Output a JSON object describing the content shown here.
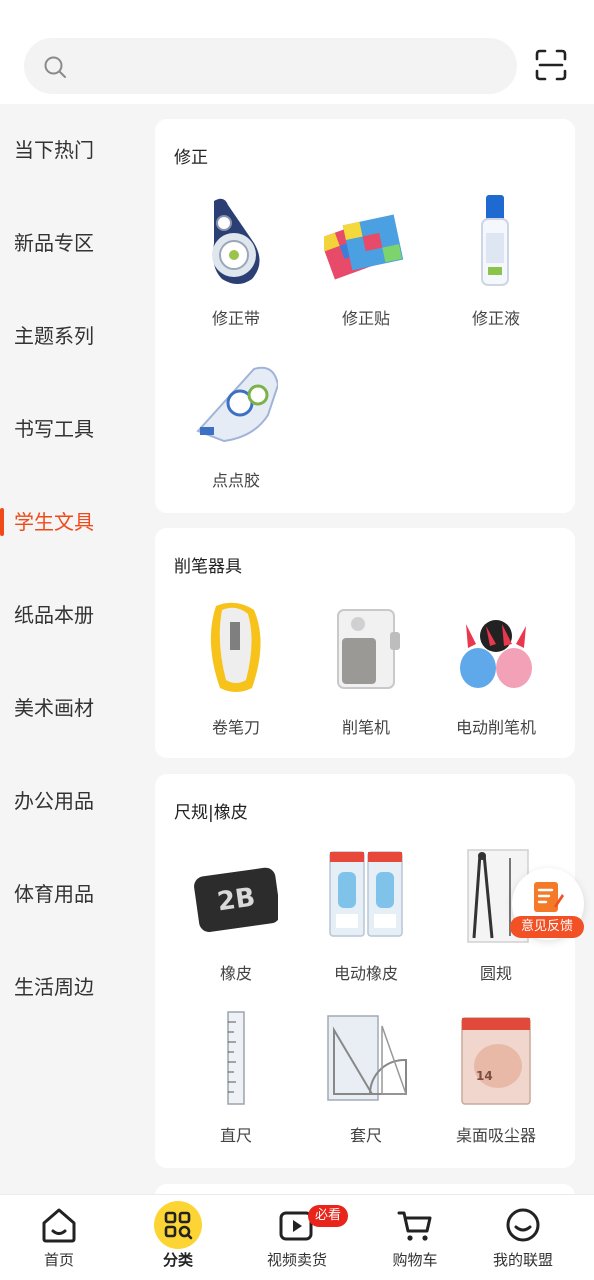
{
  "search": {
    "value": "",
    "placeholder": ""
  },
  "sidebar": {
    "items": [
      {
        "label": "当下热门"
      },
      {
        "label": "新品专区"
      },
      {
        "label": "主题系列"
      },
      {
        "label": "书写工具"
      },
      {
        "label": "学生文具"
      },
      {
        "label": "纸品本册"
      },
      {
        "label": "美术画材"
      },
      {
        "label": "办公用品"
      },
      {
        "label": "体育用品"
      },
      {
        "label": "生活周边"
      }
    ],
    "active_label": "学生文具"
  },
  "sections": [
    {
      "title": "修正",
      "items": [
        {
          "label": "修正带"
        },
        {
          "label": "修正贴"
        },
        {
          "label": "修正液"
        },
        {
          "label": "点点胶"
        }
      ]
    },
    {
      "title": "削笔器具",
      "items": [
        {
          "label": "卷笔刀"
        },
        {
          "label": "削笔机"
        },
        {
          "label": "电动削笔机"
        }
      ]
    },
    {
      "title": "尺规|橡皮",
      "items": [
        {
          "label": "橡皮"
        },
        {
          "label": "电动橡皮"
        },
        {
          "label": "圆规"
        },
        {
          "label": "直尺"
        },
        {
          "label": "套尺"
        },
        {
          "label": "桌面吸尘器"
        }
      ]
    }
  ],
  "product_print": {
    "eraser": "2B",
    "vacuum": "14"
  },
  "feedback": {
    "label": "意见反馈"
  },
  "bottom_nav": {
    "items": [
      {
        "label": "首页",
        "icon": "home-icon"
      },
      {
        "label": "分类",
        "icon": "category-icon"
      },
      {
        "label": "视频卖货",
        "icon": "video-icon",
        "badge": "必看"
      },
      {
        "label": "购物车",
        "icon": "cart-icon"
      },
      {
        "label": "我的联盟",
        "icon": "smile-icon"
      }
    ]
  },
  "colors": {
    "accent": "#f04a1a",
    "badge": "#e8241b",
    "category_active": "#fcd535",
    "feedback": "#f25025"
  }
}
